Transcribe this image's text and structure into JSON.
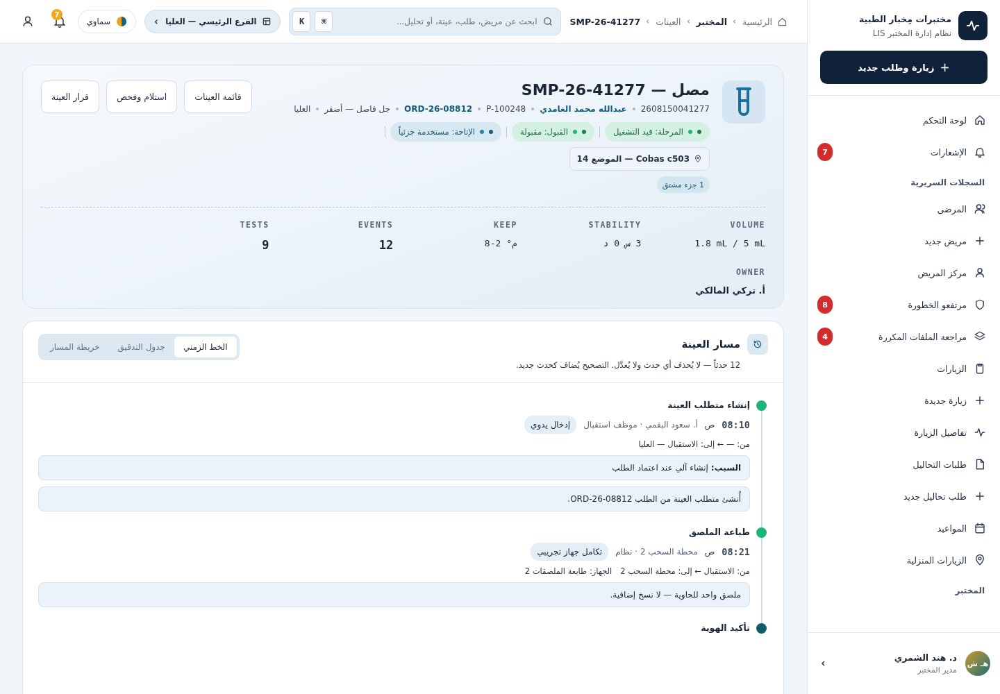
{
  "sidebar": {
    "brand": {
      "title": "مختبرات مِخبار الطبية",
      "subtitle": "نظام إدارة المختبر LIS"
    },
    "primary_button": {
      "icon": "+",
      "label": "زيارة وطلب جديد"
    },
    "sections": [
      {
        "items": [
          {
            "label": "لوحة التحكم",
            "selected": false
          },
          {
            "label": "الإشعارات",
            "selected": false,
            "badge": "7"
          }
        ]
      },
      {
        "title": "السجلات السريرية",
        "items": [
          {
            "label": "المرضى",
            "selected": false
          },
          {
            "label": "مريض جديد",
            "selected": false
          },
          {
            "label": "مركز المريض",
            "selected": false
          },
          {
            "label": "مرتفعو الخطورة",
            "selected": false,
            "badge": "8"
          },
          {
            "label": "مراجعة الملفات المكررة",
            "selected": false,
            "badge": "4"
          },
          {
            "label": "الزيارات",
            "selected": false
          },
          {
            "label": "زيارة جديدة",
            "selected": false
          },
          {
            "label": "تفاصيل الزيارة",
            "selected": false
          },
          {
            "label": "طلبات التحاليل",
            "selected": false
          },
          {
            "label": "طلب تحاليل جديد",
            "selected": false
          },
          {
            "label": "المواعيد",
            "selected": false
          },
          {
            "label": "الزيارات المنزلية",
            "selected": false
          }
        ]
      },
      {
        "title": "المختبر"
      }
    ],
    "user": {
      "initials": "هـ ش",
      "name": "د. هند الشمري",
      "role": "مدير المختبر"
    }
  },
  "topbar": {
    "breadcrumb": [
      {
        "label": "الرئيسية",
        "current": false
      },
      {
        "label": "المختبر",
        "current": true
      },
      {
        "label": "العينات",
        "current": false
      },
      {
        "label": "SMP-26-41277",
        "current": true
      }
    ],
    "search": {
      "placeholder": "ابحث عن مريض، طلب، عينة، أو تحليل...",
      "keys": [
        "⌘",
        "K"
      ]
    },
    "branch": "الفرع الرئيسي — العليا",
    "theme": "سماوي",
    "notifications_badge": "7"
  },
  "sample": {
    "title": "مصل — SMP-26-41277",
    "meta": [
      {
        "text": "2608150041277",
        "link": false
      },
      {
        "text": "عبدالله محمد الغامدي",
        "link": true
      },
      {
        "text": "P-100248",
        "link": false
      },
      {
        "text": "ORD-26-08812",
        "link": true
      },
      {
        "text": "جل فاصل — أصفر",
        "link": false
      },
      {
        "text": "العليا",
        "link": false
      }
    ],
    "chips": [
      {
        "label": "المرحلة: قيد التشغيل",
        "kind": "success"
      },
      {
        "label": "القبول: مقبولة",
        "kind": "success"
      },
      {
        "label": "الإتاحة: مستخدمة جزئياً",
        "kind": "info"
      }
    ],
    "location": "Cobas c503 — الموضع 14",
    "derived": "1 جزء مشتق",
    "buttons": [
      "قائمة العينات",
      "استلام وفحص",
      "قرار العينة"
    ],
    "stats": [
      {
        "label": "VOLUME",
        "value": "1.8 mL / 5 mL"
      },
      {
        "label": "STABILITY",
        "value": "3 س 0 د"
      },
      {
        "label": "KEEP",
        "value": "م° 2-8"
      },
      {
        "label": "EVENTS",
        "value": "12"
      },
      {
        "label": "TESTS",
        "value": "9"
      },
      {
        "label": "OWNER",
        "value": "أ. تركي المالكي"
      }
    ]
  },
  "trail": {
    "title": "مسار العينة",
    "subtitle": "12 حدثاً — لا يُحذف أي حدث ولا يُعدَّل. التصحيح يُضاف كحدث جديد.",
    "tabs": [
      {
        "label": "الخط الزمني",
        "selected": true
      },
      {
        "label": "جدول التدقيق",
        "selected": false
      },
      {
        "label": "خريطة المسار",
        "selected": false
      }
    ],
    "events": [
      {
        "title": "إنشاء متطلب العينة",
        "color": "#1bb57c",
        "time": "08:10",
        "period": "ص",
        "actor": "أ. سعود البقمي · موظف استقبال",
        "tag": "إدخال يدوي",
        "route": [
          "من: — ← إلى: الاستقبال — العليا"
        ],
        "notes": [
          "**السبب:** إنشاء آلي عند اعتماد الطلب",
          "أُنشئ متطلب العينة من الطلب ORD-26-08812."
        ]
      },
      {
        "title": "طباعة الملصق",
        "color": "#1bb57c",
        "time": "08:21",
        "period": "ص",
        "actor": "محطة السحب 2 · نظام",
        "tag": "تكامل جهاز تجريبي",
        "route": [
          "من: الاستقبال ← إلى: محطة السحب 2",
          "الجهاز: طابعة الملصقات 2"
        ],
        "notes": [
          "ملصق واحد للحاوية — لا نسخ إضافية."
        ]
      },
      {
        "title": "تأكيد الهوية",
        "color": "#0f5c6b"
      }
    ]
  }
}
